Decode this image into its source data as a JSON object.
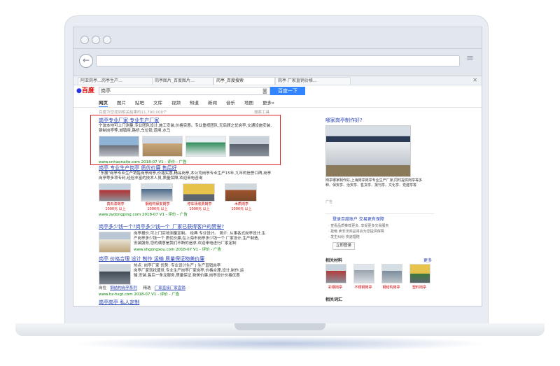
{
  "browser": {
    "tabs": [
      "阿亚岗亭…岗亭生产…",
      "岗亭图片_百度图片…",
      "岗亭_百度搜索",
      "岗亭 厂家直销价格…"
    ],
    "menu_icon": "hamburger-icon",
    "back_icon": "back-arrow-icon"
  },
  "search": {
    "logo": "百度",
    "query": "岗亭",
    "button": "百度一下",
    "nav": [
      "网页",
      "图片",
      "贴吧",
      "文库",
      "视频",
      "知道",
      "新闻",
      "音乐",
      "地图",
      "更多»"
    ],
    "stats": "百度为您找到相关结果约11,790,000个",
    "tools": "搜索工具"
  },
  "results": [
    {
      "title": "岗亭专业厂家 专业生产厂家",
      "desc": "宁波本地可上门测量,专业团队设计,施工安装,价格实惠。专业重视团队,无后顾之忧岗亭,交通设施安装,钢制岗亭等,城镇用,路桥,车位锁,道闸,水马",
      "thumbs": [
        "",
        "",
        "",
        ""
      ],
      "url": "www.cnhaonaite.com  2018-07  V1  - 评价 - 广告"
    },
    {
      "title": "岗亭 专业生产岗亭 质优价廉 售后好",
      "desc1": "\"东展\"岗亭专业生产销售岗亭岗亭,价格实惠,精品岗亭,本公司岗亭专业生产15年,九年的信誉口碑,岗亭",
      "desc2": "岗亭等多项专利,经验丰富的技术人员,质量保障,欢迎来电咨询",
      "items": [
        {
          "name": "真石漆岗亭",
          "price": "1000元 以上"
        },
        {
          "name": "钢结构保安岗亭",
          "price": "1000元 以上"
        },
        {
          "name": "停车场收费岗亭",
          "price": "1000元 以上"
        },
        {
          "name": "木质岗亭",
          "price": "1000元 以上"
        }
      ],
      "url": "www.zydongping.com  2018-07  V1  - 评价 - 广告"
    },
    {
      "title": "岗亭多少钱一个?岗亭多少钱一个_厂家已获得客户的赞誉?",
      "desc1": "岗亭报价,可上门实地测量定制。 经典 专业设计。 简介: 从事各式岗亭设计,生",
      "desc2": "产岗亭多少钱一个 质优价廉,在上海市岗亭多少钱一个 厂家设计,生产制造,",
      "desc3": "安装服务,您的满意是我们不断的追求,欢迎来电进行厂家定制",
      "url": "www.shgongxou.com  2018-07  V1  - 评价 - 广告"
    },
    {
      "title": "岗亭 价格合理 设计 制作 运输 质量保证物美价廉",
      "desc1": "热点: 岗亭厂家   优势: 专业设计生产 | 生产直销岗亭",
      "desc2": "岗亭厂家就找盛世,专业生产岗亭厂家岗亭,价格合理,设计,制作,运",
      "desc3": "输,安装,售后一条龙服务,质量保证,物美价廉,岗亭设计价格优惠",
      "links": [
        "岗位",
        "钢结构岗亭系列",
        "精选",
        "厂家直接厂家直销"
      ],
      "url": "www.hz-hsgt.com  2018-07  V1  - 评价 - 广告"
    },
    {
      "title": "岗亭岗亭 私人定制"
    }
  ],
  "sidebar": {
    "title": "哪家岗亭制作好?",
    "desc": "岗亭哪家制作好,上海岗亭岗亭专业生产厂家,同时提供岗亭等多种、保安亭、治安亭、售货亭、报刊亭、文化亭、党建亭等",
    "ad": "广告",
    "login_title": "登录百度账户  交易更有保障",
    "login_lines": [
      "· 查看品质推荐更多, 享受更多交易服务",
      "· 拒绝 卖非法商品将会为您提供保障"
    ],
    "login_bottom": "· 发生纠纷 快速理赔",
    "login_button": "立即登录",
    "related_title": "相关材料",
    "related_more": "更多",
    "related_items": [
      "彩钢岗亭",
      "不锈钢岗亭",
      "钢结构岗亭",
      "塑料岗亭"
    ],
    "related2_title": "相关词汇"
  },
  "colors": {
    "accent": "#3385ff",
    "link": "#2440b3",
    "highlight": "#e02020",
    "url": "#008000"
  }
}
